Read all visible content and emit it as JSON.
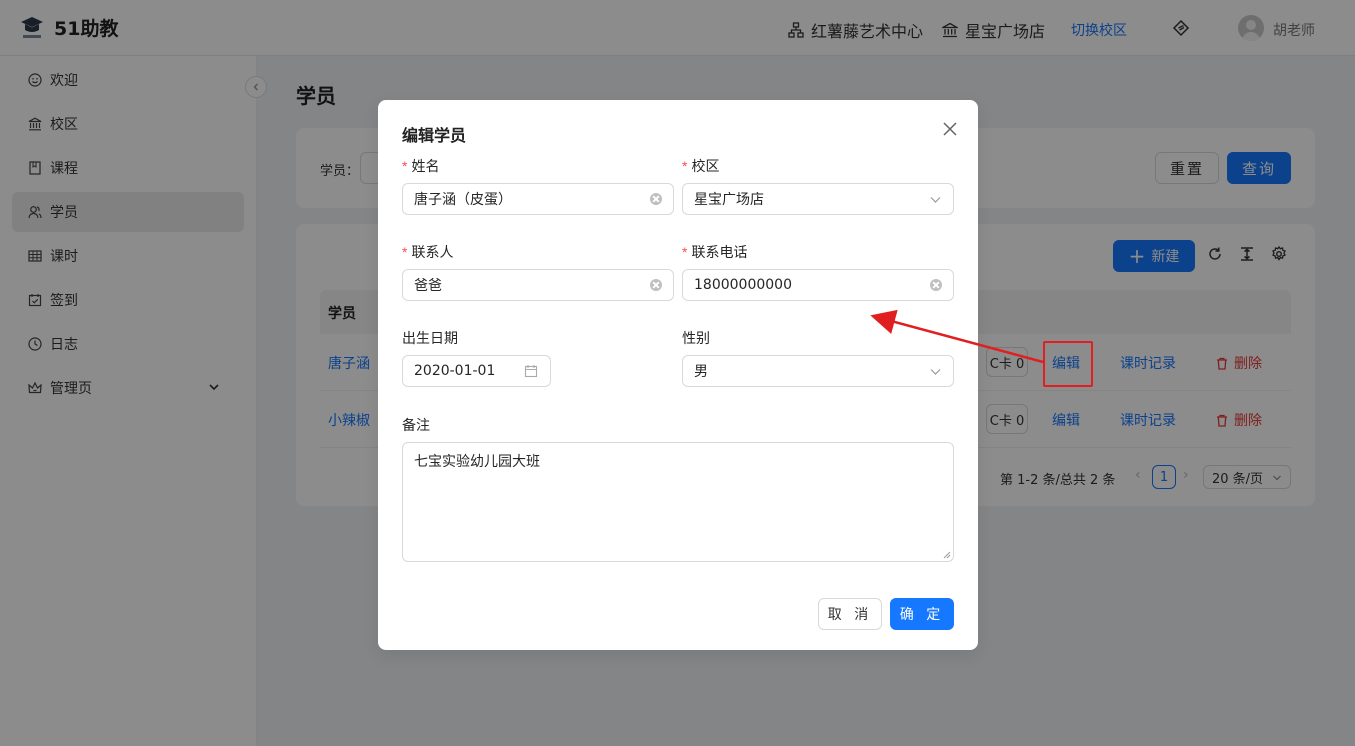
{
  "header": {
    "app_name": "51助教",
    "org_name": "红薯藤艺术中心",
    "campus_name": "星宝广场店",
    "switch_campus": "切换校区",
    "user_name": "胡老师"
  },
  "sidebar": {
    "items": [
      {
        "label": "欢迎",
        "icon": "smile-icon"
      },
      {
        "label": "校区",
        "icon": "bank-icon"
      },
      {
        "label": "课程",
        "icon": "book-icon"
      },
      {
        "label": "学员",
        "icon": "users-icon",
        "active": true
      },
      {
        "label": "课时",
        "icon": "table-icon"
      },
      {
        "label": "签到",
        "icon": "calendar-check-icon"
      },
      {
        "label": "日志",
        "icon": "clock-icon"
      },
      {
        "label": "管理页",
        "icon": "crown-icon"
      }
    ]
  },
  "page": {
    "title": "学员",
    "search_label": "学员：",
    "reset_label": "重置",
    "query_label": "查询",
    "new_label": "新建",
    "table_header_name": "学员",
    "rows": [
      {
        "name": "唐子涵",
        "ic_card": "C卡 0",
        "edit": "编辑",
        "records": "课时记录",
        "delete": "删除"
      },
      {
        "name": "小辣椒",
        "ic_card": "C卡 0",
        "edit": "编辑",
        "records": "课时记录",
        "delete": "删除"
      }
    ],
    "pager": {
      "total": "第 1-2 条/总共 2 条",
      "current": "1",
      "page_size": "20 条/页"
    }
  },
  "modal": {
    "title": "编辑学员",
    "fields": {
      "name_label": "姓名",
      "name_value": "唐子涵（皮蛋）",
      "campus_label": "校区",
      "campus_value": "星宝广场店",
      "contact_label": "联系人",
      "contact_value": "爸爸",
      "phone_label": "联系电话",
      "phone_value": "18000000000",
      "birth_label": "出生日期",
      "birth_value": "2020-01-01",
      "gender_label": "性别",
      "gender_value": "男",
      "note_label": "备注",
      "note_value": "七宝实验幼儿园大班"
    },
    "cancel_label": "取 消",
    "ok_label": "确 定"
  },
  "colors": {
    "primary": "#1677ff",
    "danger": "#e53935",
    "annotation": "#e02020"
  }
}
